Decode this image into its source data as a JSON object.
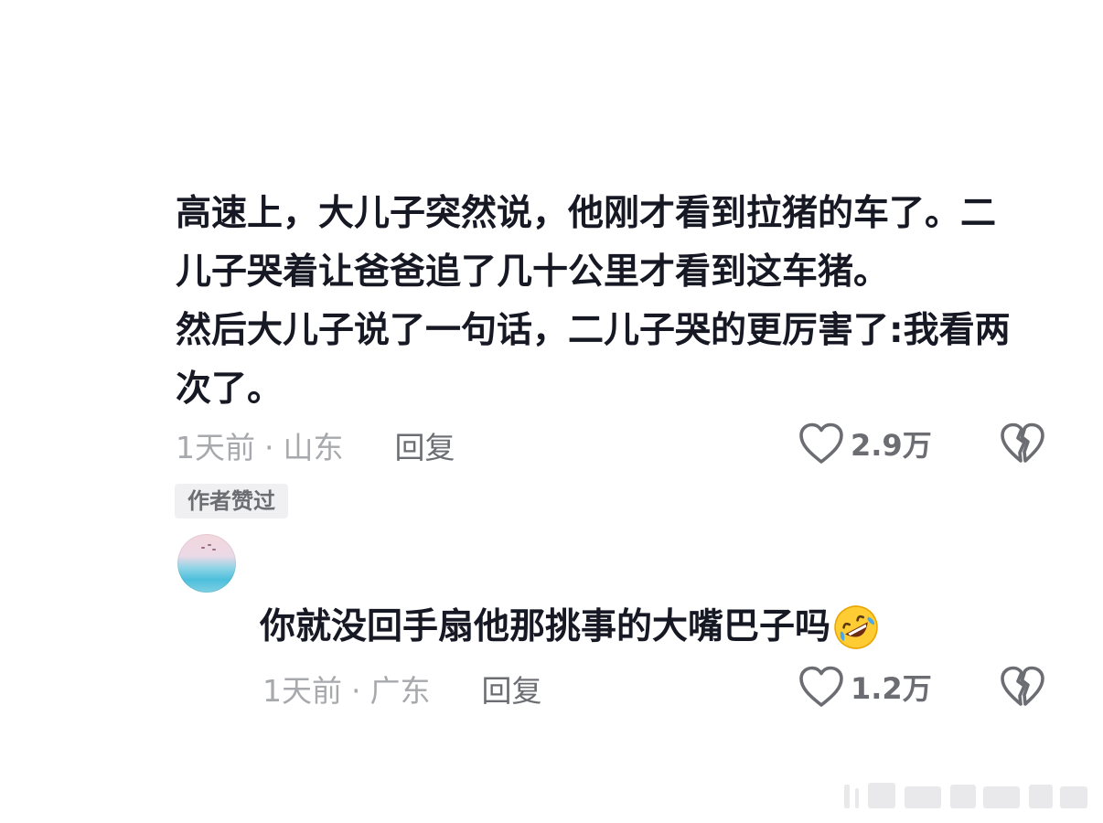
{
  "comment": {
    "lines": [
      "高速上，大儿子突然说，他刚才看到拉猪的车了。二",
      "儿子哭着让爸爸追了几十公里才看到这车猪。",
      "然后大儿子说了一句话，二儿子哭的更厉害了:我看两",
      "次了。"
    ],
    "time": "1天前",
    "location": "山东",
    "reply_label": "回复",
    "like_count": "2.9万",
    "author_badge": "作者赞过"
  },
  "reply": {
    "text": "你就没回手扇他那挑事的大嘴巴子吗",
    "emoji": "rolling-on-floor-laughing-emoji",
    "time": "1天前",
    "location": "广东",
    "reply_label": "回复",
    "like_count": "1.2万"
  },
  "separator": "·",
  "colors": {
    "text_primary": "#161823",
    "text_secondary": "#a7a9ad",
    "action_gray": "#6b6d73",
    "badge_bg": "#f0f0f2"
  }
}
